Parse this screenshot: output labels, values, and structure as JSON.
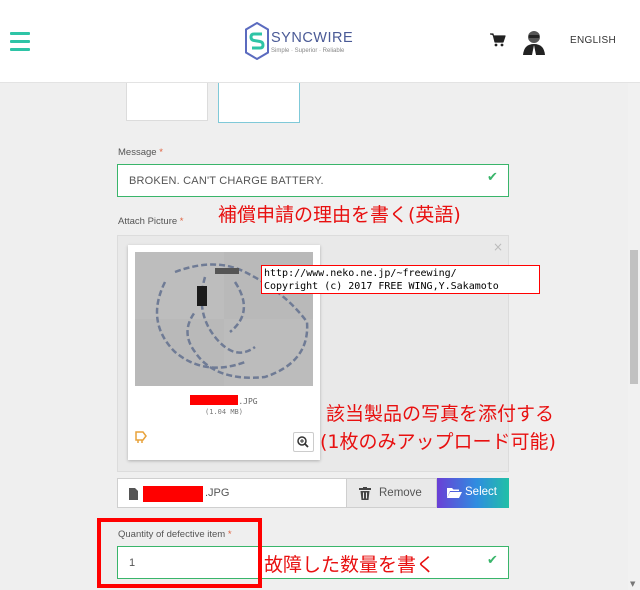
{
  "header": {
    "brand_name": "SYNCWIRE",
    "brand_tagline": "Simple · Superior · Reliable",
    "language_label": "ENGLISH"
  },
  "form": {
    "message": {
      "label": "Message",
      "required_mark": "*",
      "value": "BROKEN. CAN'T CHARGE BATTERY."
    },
    "attach": {
      "label": "Attach Picture",
      "required_mark": "*",
      "close_glyph": "×",
      "file_ext": ".JPG",
      "file_size": "(1.04 MB)",
      "selected_ext": ".JPG",
      "remove_label": "Remove",
      "select_label": "Select"
    },
    "quantity": {
      "label": "Quantity of defective item",
      "required_mark": "*",
      "value": "1"
    }
  },
  "annotations": {
    "reason_note": "補償申請の理由を書く(英語)",
    "photo_note_line1": "該当製品の写真を添付する",
    "photo_note_line2": "(1枚のみアップロード可能)",
    "quantity_note": "故障した数量を書く",
    "copyright_line1": "http://www.neko.ne.jp/~freewing/",
    "copyright_line2": "Copyright (c) 2017 FREE WING,Y.Sakamoto"
  },
  "colors": {
    "accent_green": "#39b56a",
    "brand_teal": "#2ec4a6",
    "annotation_red": "#e81010",
    "required_orange": "#e0613e"
  },
  "icons": {
    "menu": "hamburger-icon",
    "cart": "cart-icon",
    "user": "user-avatar-icon",
    "valid": "checkmark-icon",
    "file": "file-icon",
    "remove": "trash-icon",
    "select": "folder-open-icon",
    "zoom": "zoom-in-icon",
    "tag": "tag-icon"
  }
}
